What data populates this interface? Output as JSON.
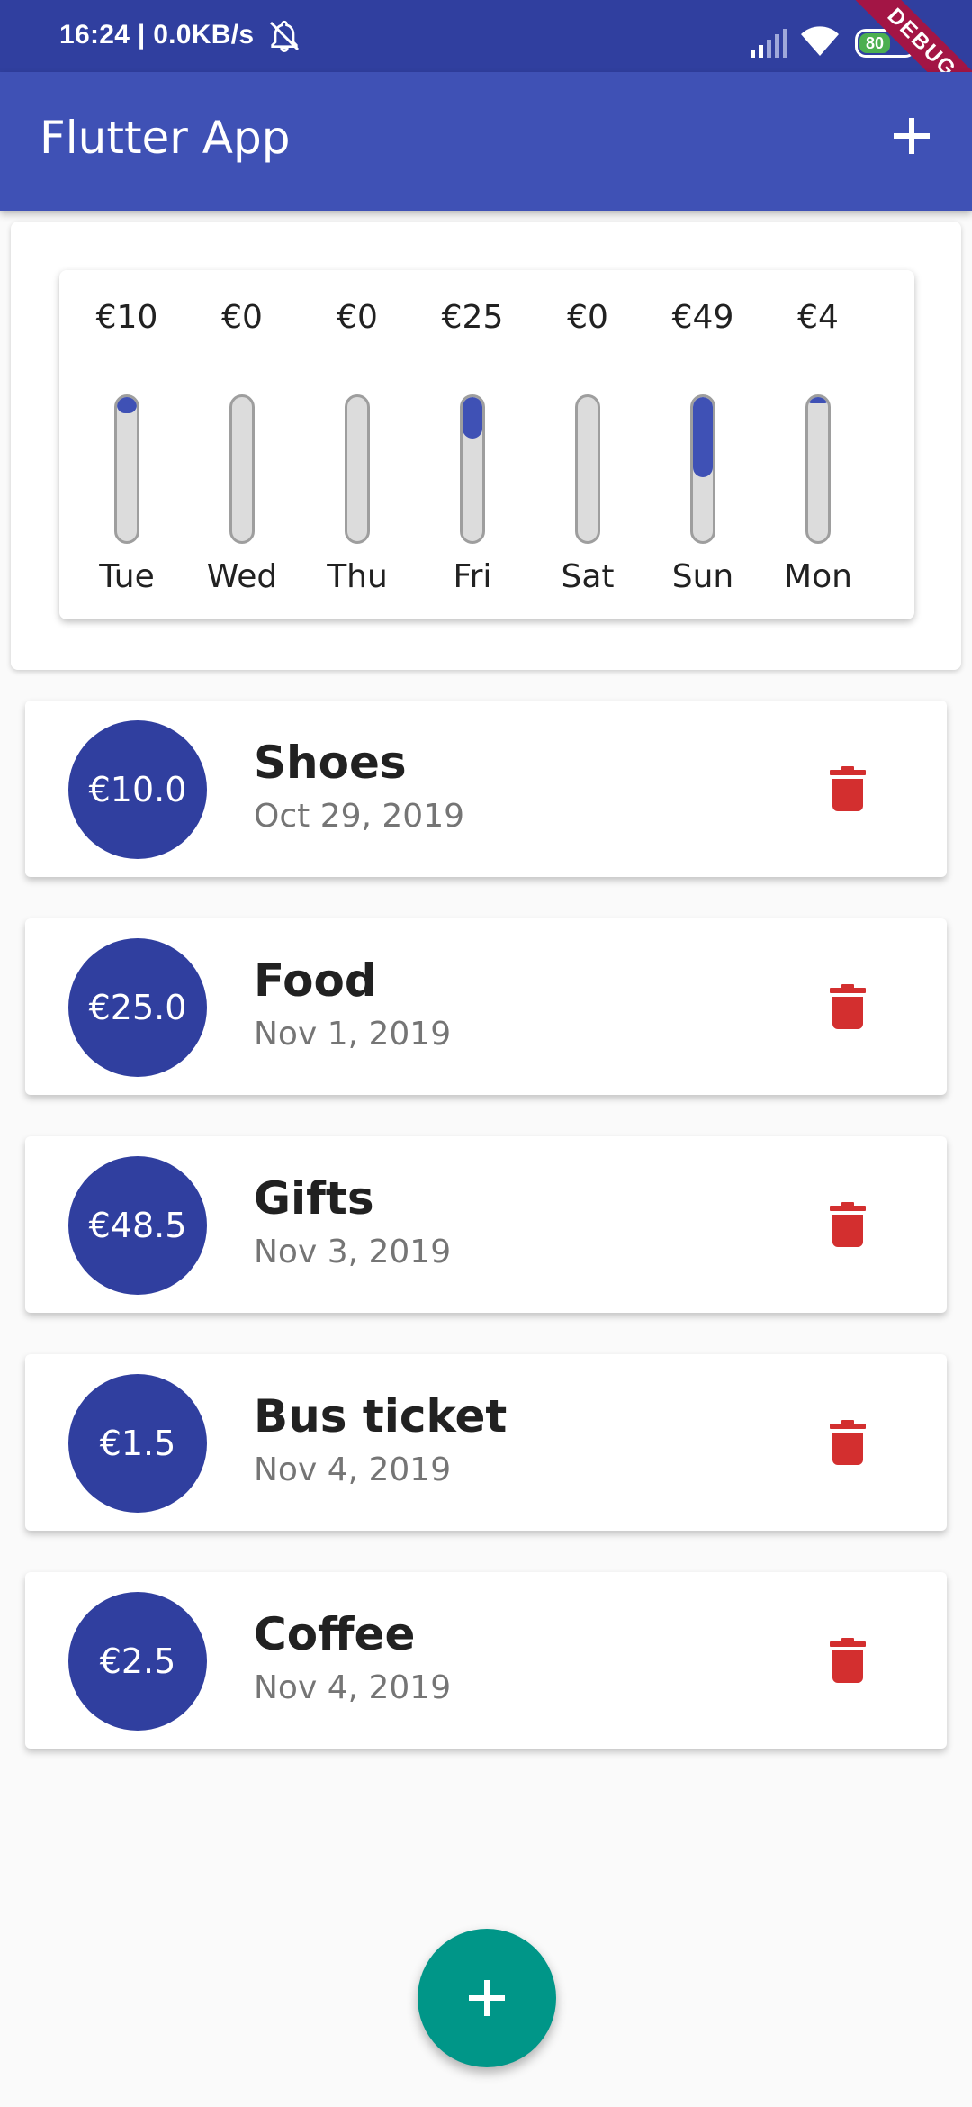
{
  "status_bar": {
    "time_and_speed": "16:24 | 0.0KB/s",
    "battery": "80",
    "debug_label": "DEBUG"
  },
  "app_bar": {
    "title": "Flutter App"
  },
  "chart_data": {
    "type": "bar",
    "categories": [
      "Tue",
      "Wed",
      "Thu",
      "Fri",
      "Sat",
      "Sun",
      "Mon"
    ],
    "labels": [
      "€10",
      "€0",
      "€0",
      "€25",
      "€0",
      "€49",
      "€4"
    ],
    "values": [
      10,
      0,
      0,
      25,
      0,
      48.5,
      4
    ],
    "ylim": [
      0,
      87.5
    ],
    "bar_color": "#3f51b5"
  },
  "transactions": [
    {
      "amount": "€10.0",
      "title": "Shoes",
      "date": "Oct 29, 2019"
    },
    {
      "amount": "€25.0",
      "title": "Food",
      "date": "Nov 1, 2019"
    },
    {
      "amount": "€48.5",
      "title": "Gifts",
      "date": "Nov 3, 2019"
    },
    {
      "amount": "€1.5",
      "title": "Bus ticket",
      "date": "Nov 4, 2019"
    },
    {
      "amount": "€2.5",
      "title": "Coffee",
      "date": "Nov 4, 2019"
    }
  ],
  "icons": {
    "add": "plus-icon",
    "delete": "trash-icon"
  },
  "colors": {
    "primary": "#3f51b5",
    "primary_dark": "#303f9f",
    "accent": "#009688",
    "delete": "#d32f2f"
  }
}
